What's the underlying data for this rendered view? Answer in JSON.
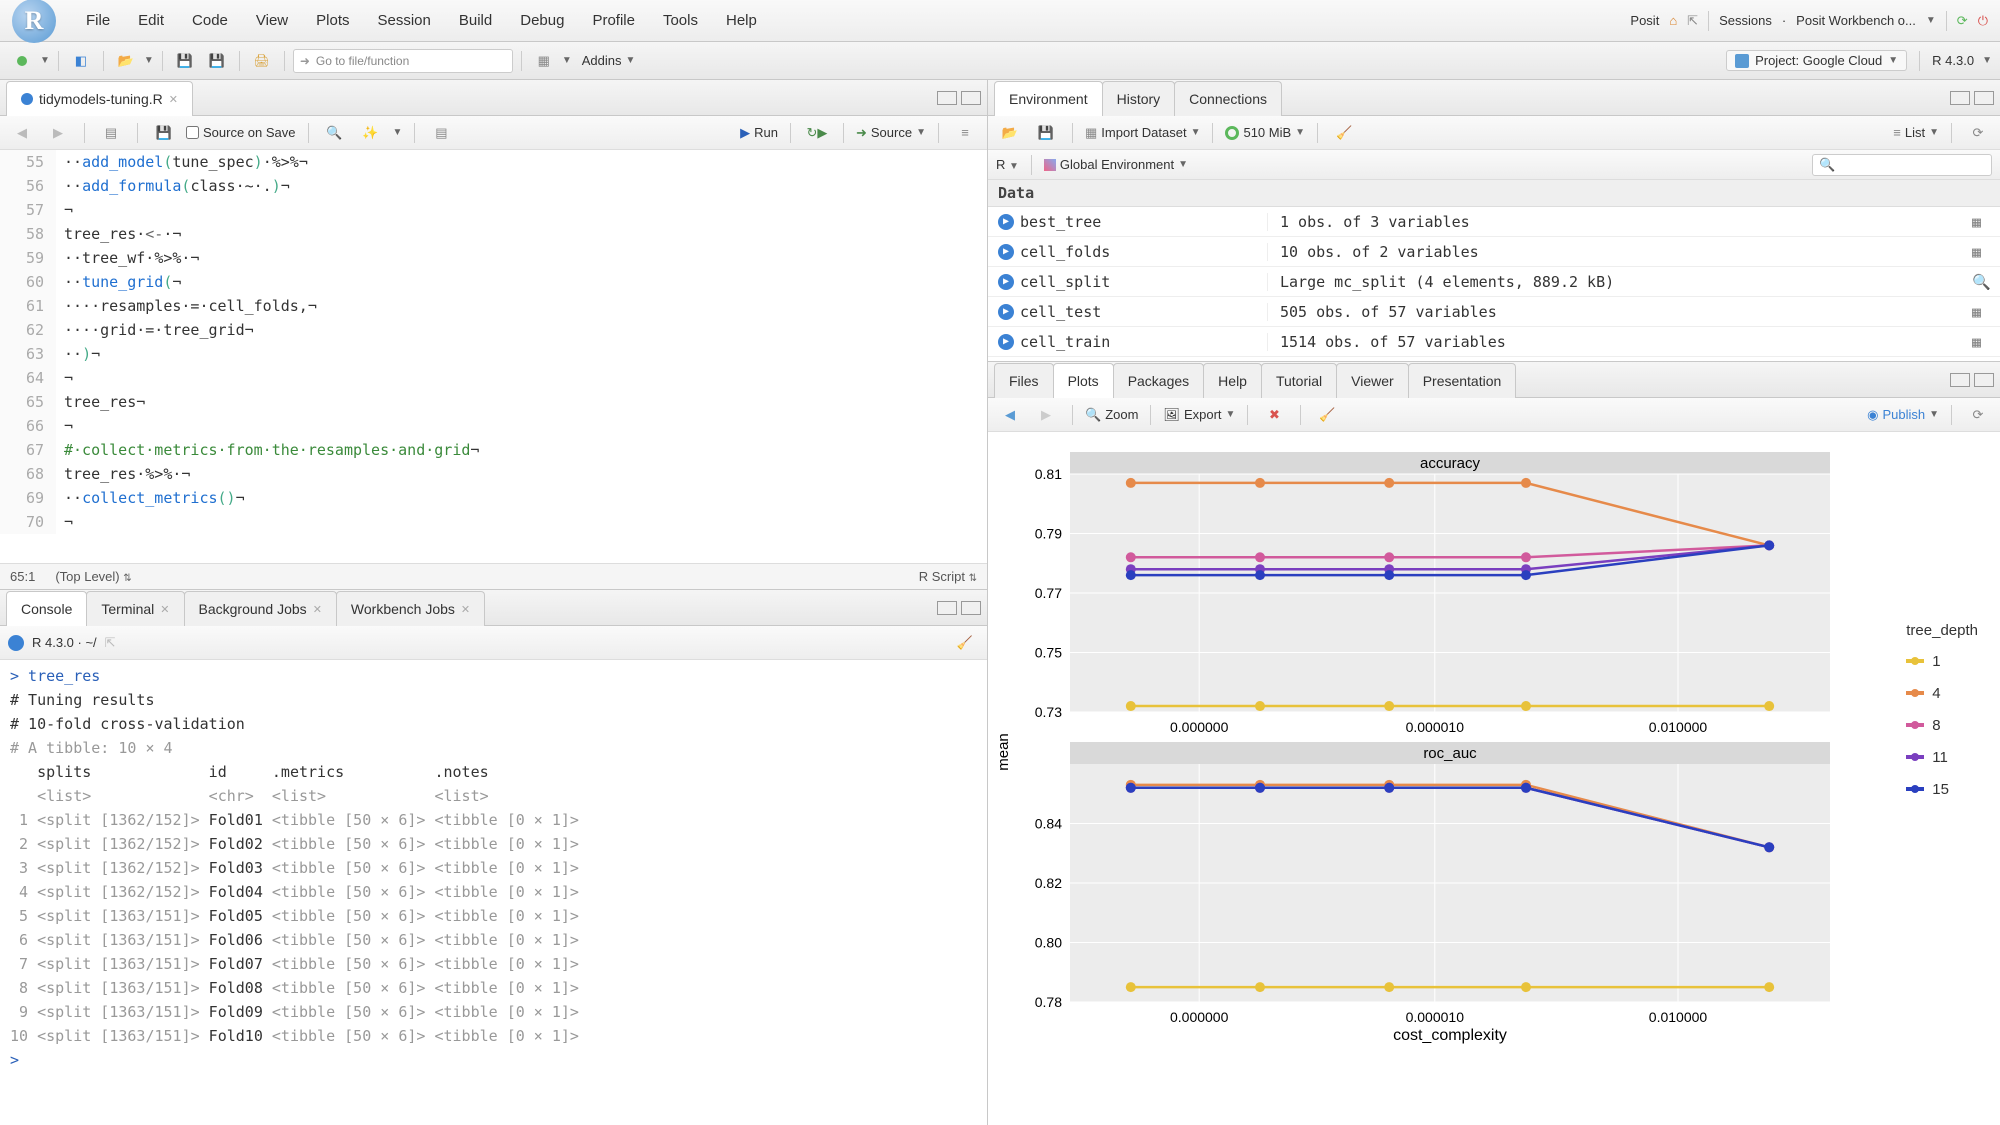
{
  "menu": [
    "File",
    "Edit",
    "Code",
    "View",
    "Plots",
    "Session",
    "Build",
    "Debug",
    "Profile",
    "Tools",
    "Help"
  ],
  "menubar_right": {
    "posit": "Posit",
    "sessions": "Sessions",
    "workbench": "Posit Workbench o..."
  },
  "toolbar": {
    "goto_placeholder": "Go to file/function",
    "addins": "Addins",
    "project_label": "Project: Google Cloud",
    "r_version": "R 4.3.0"
  },
  "source": {
    "file_tab": "tidymodels-tuning.R",
    "source_on_save": "Source on Save",
    "run": "Run",
    "source_btn": "Source",
    "status_pos": "65:1",
    "status_scope": "(Top Level)",
    "status_lang": "R Script",
    "lines": [
      {
        "n": 55,
        "html": "··<span class='tok-fn'>add_model</span><span class='tok-paren'>(</span>tune_spec<span class='tok-paren'>)</span>·<span class='tok-op'>%>%</span>¬"
      },
      {
        "n": 56,
        "html": "··<span class='tok-fn'>add_formula</span><span class='tok-paren'>(</span>class·~·.<span class='tok-paren'>)</span>¬"
      },
      {
        "n": 57,
        "html": "¬"
      },
      {
        "n": 58,
        "html": "tree_res·<span class='tok-assign'><-</span>·¬"
      },
      {
        "n": 59,
        "html": "··tree_wf·<span class='tok-op'>%>%</span>·¬"
      },
      {
        "n": 60,
        "html": "··<span class='tok-fn'>tune_grid</span><span class='tok-paren'>(</span>¬"
      },
      {
        "n": 61,
        "html": "····resamples·=·cell_folds,¬"
      },
      {
        "n": 62,
        "html": "····grid·=·tree_grid¬"
      },
      {
        "n": 63,
        "html": "··<span class='tok-paren'>)</span>¬"
      },
      {
        "n": 64,
        "html": "¬"
      },
      {
        "n": 65,
        "html": "tree_res¬"
      },
      {
        "n": 66,
        "html": "¬"
      },
      {
        "n": 67,
        "html": "<span class='tok-comment'>#·collect·metrics·from·the·resamples·and·grid</span>¬"
      },
      {
        "n": 68,
        "html": "tree_res·<span class='tok-op'>%>%</span>·¬"
      },
      {
        "n": 69,
        "html": "··<span class='tok-fn'>collect_metrics</span><span class='tok-paren'>()</span>¬"
      },
      {
        "n": 70,
        "html": "¬"
      }
    ]
  },
  "console_tabs": [
    "Console",
    "Terminal",
    "Background Jobs",
    "Workbench Jobs"
  ],
  "console": {
    "header": "R 4.3.0 · ~/",
    "lines": [
      "<span class='prompt'>> tree_res</span>",
      "# Tuning results",
      "# 10-fold cross-validation",
      "<span class='console-gray'># A tibble: 10 × 4</span>",
      "   splits             id     .metrics          .notes          ",
      "<span class='console-gray'>   &lt;list&gt;             &lt;chr&gt;  &lt;list&gt;            &lt;list&gt;          </span>",
      "<span class='console-gray'> 1</span> <span class='console-gray'>&lt;split [1362/152]&gt;</span> Fold01 <span class='console-gray'>&lt;tibble [50 × 6]&gt; &lt;tibble [0 × 1]&gt;</span>",
      "<span class='console-gray'> 2</span> <span class='console-gray'>&lt;split [1362/152]&gt;</span> Fold02 <span class='console-gray'>&lt;tibble [50 × 6]&gt; &lt;tibble [0 × 1]&gt;</span>",
      "<span class='console-gray'> 3</span> <span class='console-gray'>&lt;split [1362/152]&gt;</span> Fold03 <span class='console-gray'>&lt;tibble [50 × 6]&gt; &lt;tibble [0 × 1]&gt;</span>",
      "<span class='console-gray'> 4</span> <span class='console-gray'>&lt;split [1362/152]&gt;</span> Fold04 <span class='console-gray'>&lt;tibble [50 × 6]&gt; &lt;tibble [0 × 1]&gt;</span>",
      "<span class='console-gray'> 5</span> <span class='console-gray'>&lt;split [1363/151]&gt;</span> Fold05 <span class='console-gray'>&lt;tibble [50 × 6]&gt; &lt;tibble [0 × 1]&gt;</span>",
      "<span class='console-gray'> 6</span> <span class='console-gray'>&lt;split [1363/151]&gt;</span> Fold06 <span class='console-gray'>&lt;tibble [50 × 6]&gt; &lt;tibble [0 × 1]&gt;</span>",
      "<span class='console-gray'> 7</span> <span class='console-gray'>&lt;split [1363/151]&gt;</span> Fold07 <span class='console-gray'>&lt;tibble [50 × 6]&gt; &lt;tibble [0 × 1]&gt;</span>",
      "<span class='console-gray'> 8</span> <span class='console-gray'>&lt;split [1363/151]&gt;</span> Fold08 <span class='console-gray'>&lt;tibble [50 × 6]&gt; &lt;tibble [0 × 1]&gt;</span>",
      "<span class='console-gray'> 9</span> <span class='console-gray'>&lt;split [1363/151]&gt;</span> Fold09 <span class='console-gray'>&lt;tibble [50 × 6]&gt; &lt;tibble [0 × 1]&gt;</span>",
      "<span class='console-gray'>10</span> <span class='console-gray'>&lt;split [1363/151]&gt;</span> Fold10 <span class='console-gray'>&lt;tibble [50 × 6]&gt; &lt;tibble [0 × 1]&gt;</span>",
      "<span class='prompt'>> </span>"
    ]
  },
  "env_tabs": [
    "Environment",
    "History",
    "Connections"
  ],
  "env": {
    "import": "Import Dataset",
    "memory": "510 MiB",
    "scope_r": "R",
    "scope_global": "Global Environment",
    "list": "List",
    "section": "Data",
    "rows": [
      {
        "name": "best_tree",
        "val": "1 obs. of 3 variables",
        "action": "grid"
      },
      {
        "name": "cell_folds",
        "val": "10 obs. of 2 variables",
        "action": "grid"
      },
      {
        "name": "cell_split",
        "val": "Large mc_split (4 elements,  889.2 kB)",
        "action": "search"
      },
      {
        "name": "cell_test",
        "val": "505 obs. of 57 variables",
        "action": "grid"
      },
      {
        "name": "cell_train",
        "val": "1514 obs. of 57 variables",
        "action": "grid"
      }
    ]
  },
  "plots_tabs": [
    "Files",
    "Plots",
    "Packages",
    "Help",
    "Tutorial",
    "Viewer",
    "Presentation"
  ],
  "plots_toolbar": {
    "zoom": "Zoom",
    "export": "Export",
    "publish": "Publish"
  },
  "chart_data": {
    "type": "line",
    "x_label": "cost_complexity",
    "y_label": "mean",
    "x_ticks": [
      "0.000000",
      "0.000010",
      "0.010000"
    ],
    "x_positions": [
      0.08,
      0.25,
      0.42,
      0.6,
      0.92
    ],
    "legend_title": "tree_depth",
    "series": [
      {
        "name": "1",
        "color": "#e8c23a"
      },
      {
        "name": "4",
        "color": "#e68a4a"
      },
      {
        "name": "8",
        "color": "#d15a9c"
      },
      {
        "name": "11",
        "color": "#7a3fbf"
      },
      {
        "name": "15",
        "color": "#2a3fbf"
      }
    ],
    "facets": [
      {
        "title": "accuracy",
        "ylim": [
          0.73,
          0.81
        ],
        "y_ticks": [
          0.73,
          0.75,
          0.77,
          0.79,
          0.81
        ],
        "values": {
          "1": [
            0.732,
            0.732,
            0.732,
            0.732,
            0.732
          ],
          "4": [
            0.807,
            0.807,
            0.807,
            0.807,
            0.786
          ],
          "8": [
            0.782,
            0.782,
            0.782,
            0.782,
            0.786
          ],
          "11": [
            0.778,
            0.778,
            0.778,
            0.778,
            0.786
          ],
          "15": [
            0.776,
            0.776,
            0.776,
            0.776,
            0.786
          ]
        }
      },
      {
        "title": "roc_auc",
        "ylim": [
          0.78,
          0.86
        ],
        "y_ticks": [
          0.78,
          0.8,
          0.82,
          0.84
        ],
        "values": {
          "1": [
            0.785,
            0.785,
            0.785,
            0.785,
            0.785
          ],
          "4": [
            0.853,
            0.853,
            0.853,
            0.853,
            0.832
          ],
          "8": [
            0.852,
            0.852,
            0.852,
            0.852,
            0.832
          ],
          "11": [
            0.852,
            0.852,
            0.852,
            0.852,
            0.832
          ],
          "15": [
            0.852,
            0.852,
            0.852,
            0.852,
            0.832
          ]
        }
      }
    ]
  }
}
